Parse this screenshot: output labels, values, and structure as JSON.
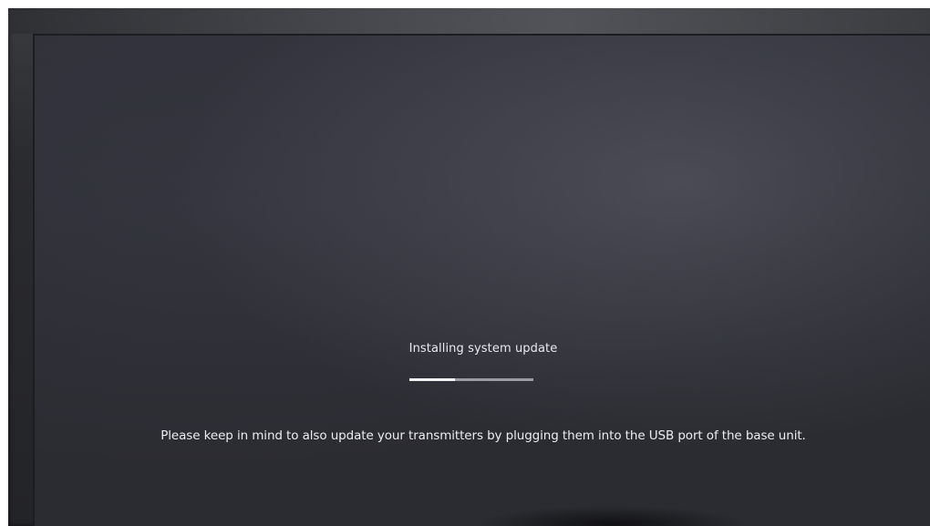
{
  "screen": {
    "title": "Installing system update",
    "notice": "Please keep in mind to also update your transmitters by plugging them into the USB port of the base unit."
  },
  "progress": {
    "fraction": 0.37
  },
  "colors": {
    "screen_background": "#2b2c31",
    "text": "#ecedf1",
    "progress_track": "#9b9ca3",
    "progress_fill": "#f4f4f7"
  }
}
